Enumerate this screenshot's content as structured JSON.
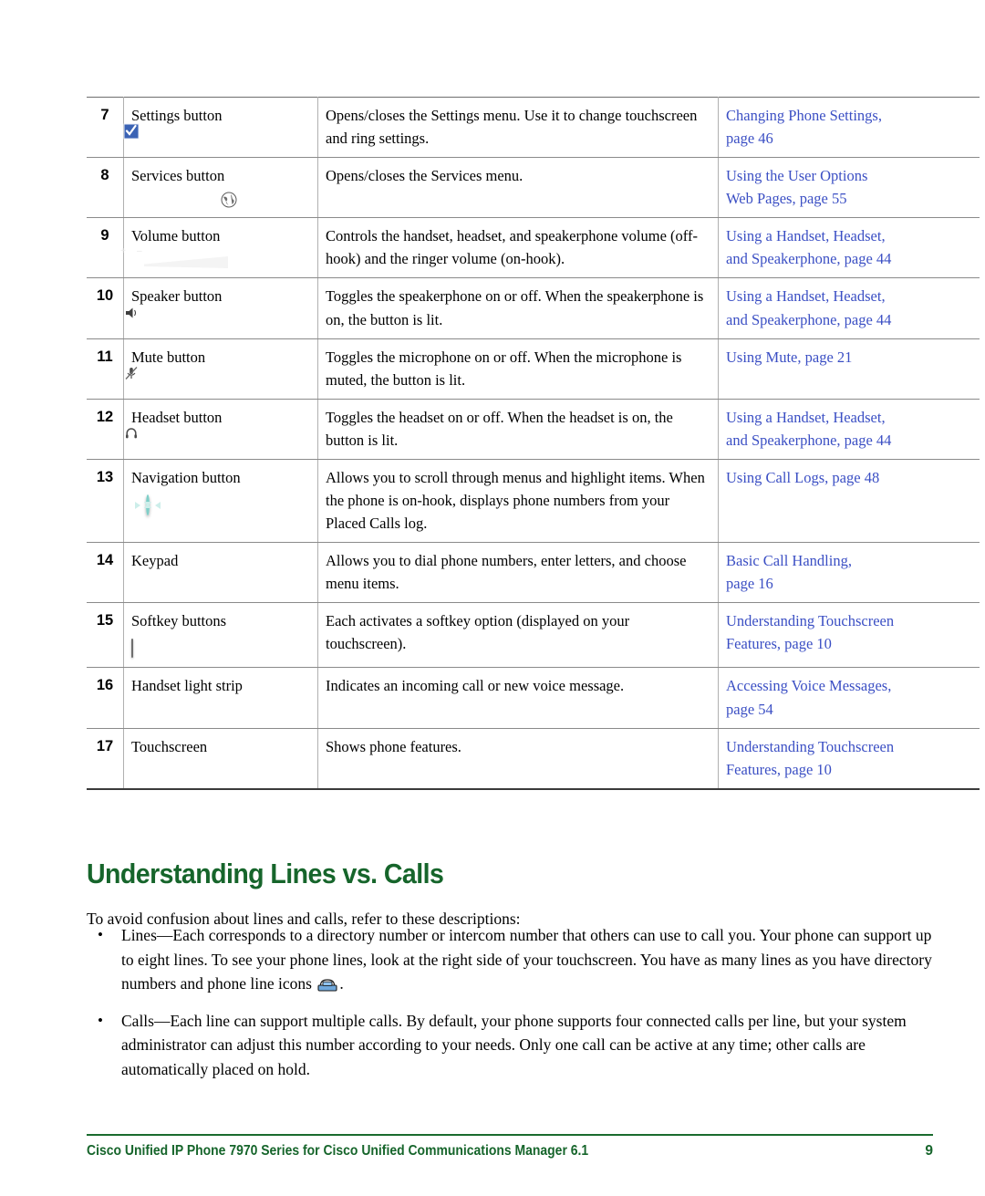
{
  "document": {
    "table": {
      "rows": [
        {
          "number": "7",
          "name": "Settings button",
          "icon": "settings-button-icon",
          "description": "Opens/closes the Settings menu. Use it to change touchscreen and ring settings.",
          "reference": [
            "Changing Phone Settings,",
            "page 46"
          ]
        },
        {
          "number": "8",
          "name": "Services button",
          "icon": "services-button-icon",
          "description": "Opens/closes the Services menu.",
          "reference": [
            "Using the User Options",
            "Web Pages, page 55"
          ]
        },
        {
          "number": "9",
          "name": "Volume button",
          "icon": "volume-button-icon",
          "description": "Controls the handset, headset, and speakerphone volume (off-hook) and the ringer volume (on-hook).",
          "reference": [
            "Using a Handset, Headset,",
            "and Speakerphone, page 44"
          ]
        },
        {
          "number": "10",
          "name": "Speaker button",
          "icon": "speaker-button-icon",
          "description": "Toggles the speakerphone on or off. When the speakerphone is on, the button is lit.",
          "reference": [
            "Using a Handset, Headset,",
            "and Speakerphone, page 44"
          ]
        },
        {
          "number": "11",
          "name": "Mute button",
          "icon": "mute-button-icon",
          "description": "Toggles the microphone on or off. When the microphone is muted, the button is lit.",
          "reference": [
            "Using Mute, page 21"
          ]
        },
        {
          "number": "12",
          "name": "Headset button",
          "icon": "headset-button-icon",
          "description": "Toggles the headset on or off. When the headset is on, the button is lit.",
          "reference": [
            "Using a Handset, Headset,",
            "and Speakerphone, page 44"
          ]
        },
        {
          "number": "13",
          "name": "Navigation button",
          "icon": "navigation-button-icon",
          "description": "Allows you to scroll through menus and highlight items. When the phone is on-hook, displays phone numbers from your Placed Calls log.",
          "reference": [
            "Using Call Logs, page 48"
          ]
        },
        {
          "number": "14",
          "name": "Keypad",
          "icon": "",
          "description": "Allows you to dial phone numbers, enter letters, and choose menu items.",
          "reference": [
            "Basic Call Handling,",
            "page 16"
          ]
        },
        {
          "number": "15",
          "name": "Softkey buttons",
          "icon": "softkey-button-icon",
          "description": "Each activates a softkey option (displayed on your touchscreen).",
          "reference": [
            "Understanding Touchscreen",
            "Features, page 10"
          ]
        },
        {
          "number": "16",
          "name": "Handset light strip",
          "icon": "",
          "description": "Indicates an incoming call or new voice message.",
          "reference": [
            "Accessing Voice Messages,",
            "page 54"
          ]
        },
        {
          "number": "17",
          "name": "Touchscreen",
          "icon": "",
          "description": "Shows phone features.",
          "reference": [
            "Understanding Touchscreen",
            "Features, page 10"
          ]
        }
      ]
    },
    "section": {
      "heading": "Understanding Lines vs. Calls",
      "intro": "To avoid confusion about lines and calls, refer to these descriptions:",
      "bullets": [
        {
          "marker": "•",
          "text_before_icon": "Lines—Each corresponds to a directory number or intercom number that others can use to call you. Your phone can support up to eight lines. To see your phone lines, look at the right side of your touchscreen. You have as many lines as you have directory numbers and phone line icons ",
          "icon": "phone-line-icon",
          "text_after_icon": "."
        },
        {
          "marker": "•",
          "text_before_icon": "Calls—Each line can support multiple calls. By default, your phone supports four connected calls per line, but your system administrator can adjust this number according to your needs. Only one call can be active at any time; other calls are automatically placed on hold.",
          "icon": "",
          "text_after_icon": ""
        }
      ]
    },
    "footer": {
      "title": "Cisco Unified IP Phone 7970 Series for Cisco Unified Communications Manager 6.1",
      "page_number": "9"
    },
    "colors": {
      "heading_green": "#16652b",
      "link_blue": "#3b4fc4",
      "footer_rule": "#1a6b2e"
    }
  }
}
